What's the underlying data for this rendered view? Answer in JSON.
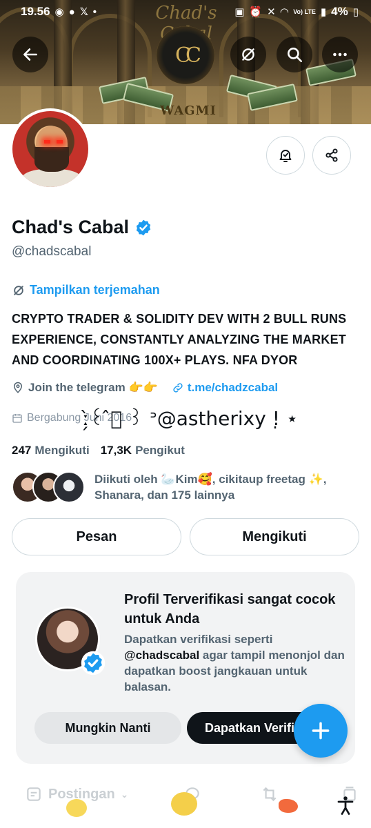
{
  "status_bar": {
    "time": "19.56",
    "battery": "4%",
    "network": "Vo) LTE"
  },
  "banner": {
    "title": "Chad's Cabal",
    "subtitle": "WAGMI",
    "emblem": "CC"
  },
  "profile": {
    "display_name": "Chad's Cabal",
    "handle": "@chadscabal",
    "translate_label": "Tampilkan terjemahan",
    "bio_lines": [
      "CRYPTO TRADER & SOLIDITY DEV WITH 2 BULL RUNS",
      "EXPERIENCE, CONSTANTLY ANALYZING THE MARKET",
      "AND COORDINATING 100X+ PLAYS. NFA DYOR"
    ],
    "location": "Join the telegram 👉👉",
    "link": "t.me/chadzcabal",
    "joined": "Bergabung Juni 2016",
    "following_count": "247",
    "following_label": "Mengikuti",
    "followers_count": "17,3K",
    "followers_label": "Pengikut",
    "followed_by_line1": "Diikuti oleh 🦢Kim🥰, cikitaup freetag ✨,",
    "followed_by_line2": "Shanara, dan 175 lainnya"
  },
  "actions": {
    "message": "Pesan",
    "following": "Mengikuti"
  },
  "overlay": {
    "text": "ː̗̀꒰ ̂⃝ ꒱ ᐣ@astherixy !̣ ⋆"
  },
  "verify_card": {
    "title": "Profil Terverifikasi sangat cocok untuk Anda",
    "desc_prefix": "Dapatkan verifikasi seperti",
    "desc_handle": "@chadscabal",
    "desc_suffix": "agar tampil menonjol dan dapatkan boost jangkauan untuk balasan.",
    "later": "Mungkin Nanti",
    "get": "Dapatkan Verifikasi"
  },
  "tabs": {
    "posts": "Postingan"
  },
  "colors": {
    "accent": "#1d9bf0",
    "text": "#0f1419",
    "muted": "#536471"
  },
  "icons": [
    "back-arrow-icon",
    "translate-icon",
    "search-icon",
    "more-icon",
    "bell-icon",
    "share-icon",
    "verified-badge-icon",
    "location-icon",
    "link-icon",
    "calendar-icon",
    "plus-icon",
    "accessibility-icon"
  ]
}
